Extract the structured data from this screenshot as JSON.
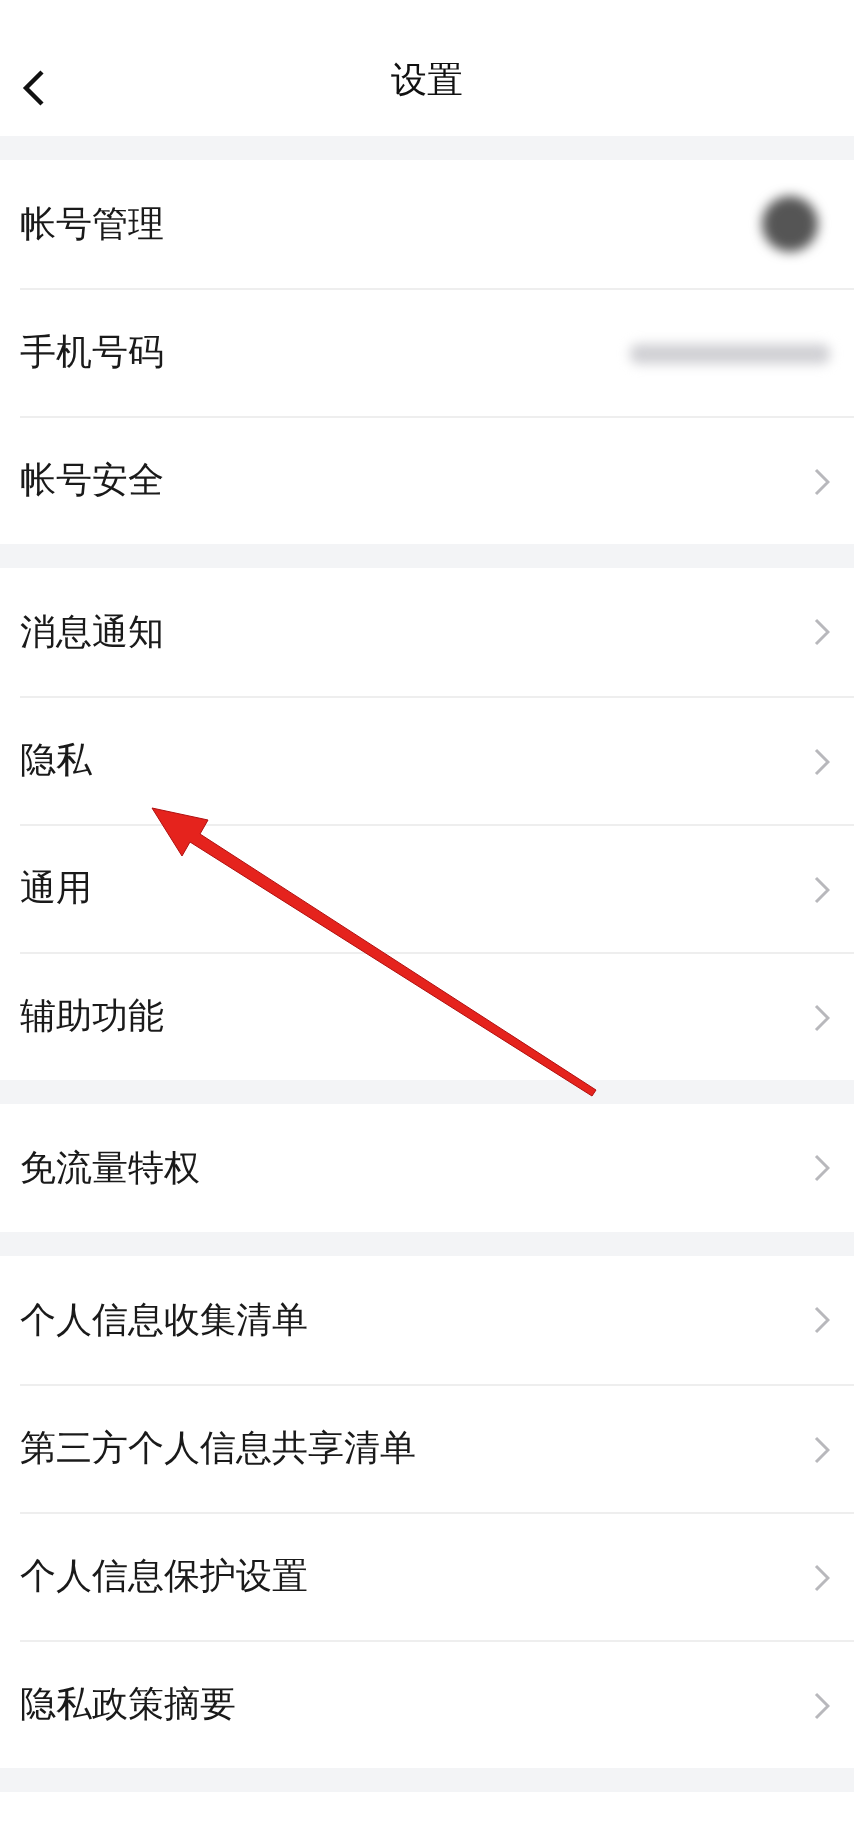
{
  "nav_bar": {
    "title": "设置"
  },
  "sections": [
    {
      "items": [
        {
          "label": "帐号管理",
          "kind": "avatar"
        },
        {
          "label": "手机号码",
          "kind": "masked"
        },
        {
          "label": "帐号安全",
          "kind": "chevron"
        }
      ]
    },
    {
      "items": [
        {
          "label": "消息通知",
          "kind": "chevron"
        },
        {
          "label": "隐私",
          "kind": "chevron"
        },
        {
          "label": "通用",
          "kind": "chevron"
        },
        {
          "label": "辅助功能",
          "kind": "chevron"
        }
      ]
    },
    {
      "items": [
        {
          "label": "免流量特权",
          "kind": "chevron"
        }
      ]
    },
    {
      "items": [
        {
          "label": "个人信息收集清单",
          "kind": "chevron"
        },
        {
          "label": "第三方个人信息共享清单",
          "kind": "chevron"
        },
        {
          "label": "个人信息保护设置",
          "kind": "chevron"
        },
        {
          "label": "隐私政策摘要",
          "kind": "chevron"
        }
      ]
    }
  ]
}
